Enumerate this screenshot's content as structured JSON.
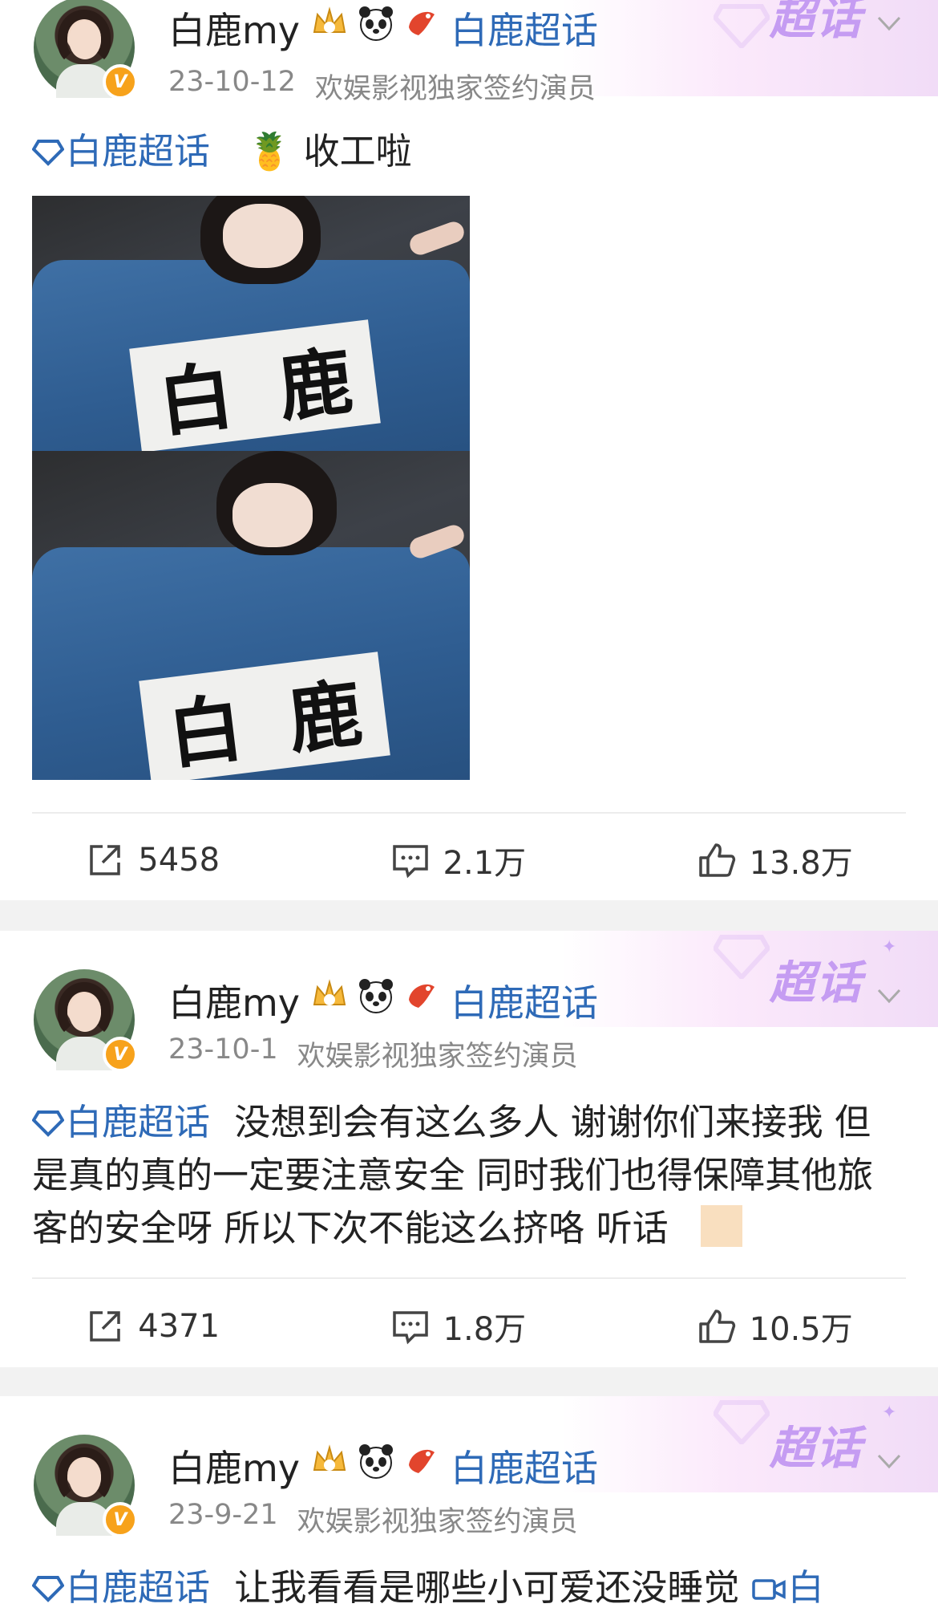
{
  "posts": [
    {
      "author": "白鹿my",
      "topic_badge": "白鹿超话",
      "banner_text": "超话",
      "date": "23-10-12",
      "source": "欢娱影视独家签约演员",
      "tag": "白鹿超话",
      "text_emoji": "🍍",
      "text": "收工啦",
      "photos": [
        {
          "label_left": "白",
          "label_right": "鹿"
        },
        {
          "label_left": "白",
          "label_right": "鹿"
        }
      ],
      "reposts": "5458",
      "comments": "2.1万",
      "likes": "13.8万"
    },
    {
      "author": "白鹿my",
      "topic_badge": "白鹿超话",
      "banner_text": "超话",
      "date": "23-10-1",
      "source": "欢娱影视独家签约演员",
      "tag": "白鹿超话",
      "text": "没想到会有这么多人 谢谢你们来接我 但是真的真的一定要注意安全 同时我们也得保障其他旅客的安全呀 所以下次不能这么挤咯 听话",
      "reposts": "4371",
      "comments": "1.8万",
      "likes": "10.5万"
    },
    {
      "author": "白鹿my",
      "topic_badge": "白鹿超话",
      "banner_text": "超话",
      "date": "23-9-21",
      "source": "欢娱影视独家签约演员",
      "tag": "白鹿超话",
      "text": "让我看看是哪些小可爱还没睡觉",
      "trailing_link": "白"
    }
  ],
  "colors": {
    "link": "#2e6ab7",
    "meta": "#888888",
    "separator": "#f2f2f2",
    "verified": "#f7a21b",
    "chaohua": "#c59cf2"
  },
  "icons": {
    "verified": "v-badge-icon",
    "crown": "crown-level-icon",
    "panda": "panda-icon",
    "fish": "fish-icon",
    "chevron": "chevron-down-icon",
    "repost": "repost-icon",
    "comment": "comment-icon",
    "like": "like-icon",
    "topic": "diamond-topic-icon",
    "video": "video-link-icon"
  }
}
